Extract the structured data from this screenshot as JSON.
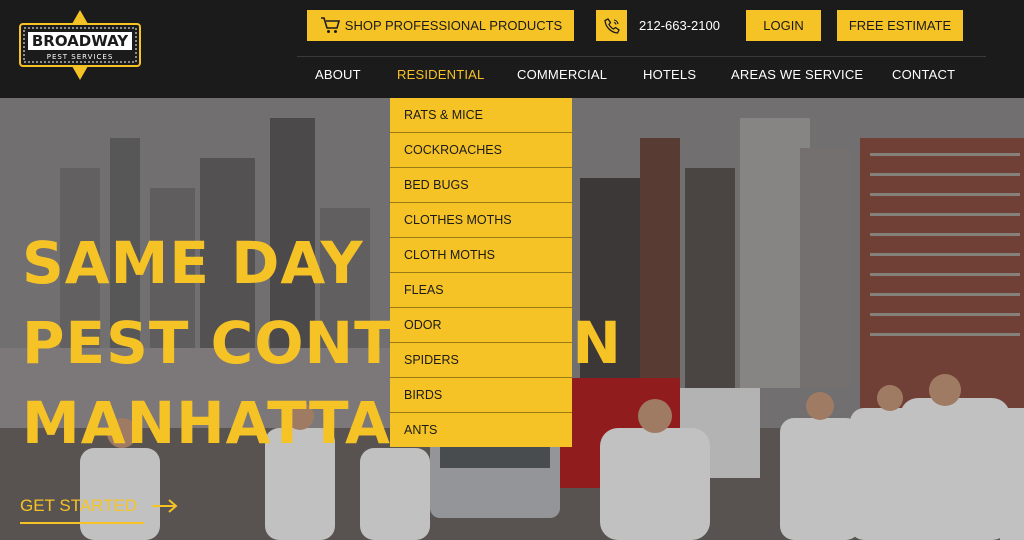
{
  "logo": {
    "top": "BROADWAY",
    "bottom": "PEST SERVICES"
  },
  "utility": {
    "shop_label": "SHOP PROFESSIONAL PRODUCTS",
    "phone": "212-663-2100",
    "login_label": "LOGIN",
    "estimate_label": "FREE ESTIMATE"
  },
  "nav": {
    "items": [
      {
        "label": "ABOUT"
      },
      {
        "label": "RESIDENTIAL",
        "active": true
      },
      {
        "label": "COMMERCIAL"
      },
      {
        "label": "HOTELS"
      },
      {
        "label": "AREAS WE SERVICE"
      },
      {
        "label": "CONTACT"
      }
    ]
  },
  "dropdown": {
    "items": [
      "RATS & MICE",
      "COCKROACHES",
      "BED BUGS",
      "CLOTHES MOTHS",
      "CLOTH MOTHS",
      "FLEAS",
      "ODOR",
      "SPIDERS",
      "BIRDS",
      "ANTS"
    ]
  },
  "hero": {
    "line1": "SAME DAY",
    "line2": "PEST CONTROL IN",
    "line3": "MANHATTAN",
    "cta": "GET STARTED"
  },
  "colors": {
    "accent": "#f6c327",
    "header_bg": "#1b1b1b"
  }
}
